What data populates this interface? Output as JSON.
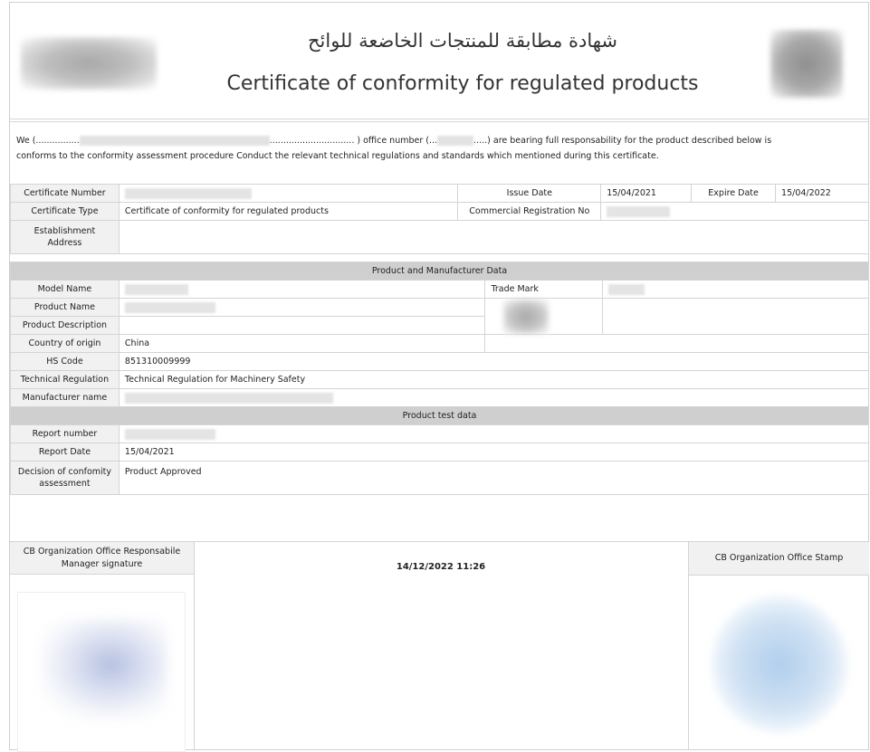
{
  "header": {
    "title_ar": "شهادة مطابقة للمنتجات الخاضعة للوائح",
    "title_en": "Certificate of conformity for regulated products"
  },
  "intro": {
    "part1": "We (................",
    "part2": "............................... ) office number (...",
    "part3": ".....) are bearing full responsability for the product described below is",
    "line2": "conforms to the conformity assessment procedure Conduct the relevant technical regulations and standards which mentioned during this certificate."
  },
  "certificate": {
    "number_label": "Certificate Number",
    "issue_date_label": "Issue Date",
    "issue_date": "15/04/2021",
    "expire_date_label": "Expire Date",
    "expire_date": "15/04/2022",
    "type_label": "Certificate Type",
    "type_value": "Certificate of conformity for regulated products",
    "cr_label": "Commercial Registration No",
    "address_label": "Establishment Address"
  },
  "product": {
    "section_title": "Product and Manufacturer Data",
    "model_label": "Model Name",
    "trademark_label": "Trade Mark",
    "name_label": "Product Name",
    "description_label": "Product Description",
    "country_label": "Country of origin",
    "country_value": "China",
    "hs_label": "HS Code",
    "hs_value": "851310009999",
    "regulation_label": "Technical Regulation",
    "regulation_value": "Technical Regulation for Machinery Safety",
    "manufacturer_label": "Manufacturer name"
  },
  "test": {
    "section_title": "Product test data",
    "report_number_label": "Report number",
    "report_date_label": "Report Date",
    "report_date_value": "15/04/2021",
    "decision_label": "Decision of confomity assessment",
    "decision_value": "Product Approved"
  },
  "signature": {
    "manager_label": "CB Organization Office Responsabile Manager signature",
    "timestamp": "14/12/2022 11:26",
    "stamp_label": "CB Organization Office Stamp"
  }
}
